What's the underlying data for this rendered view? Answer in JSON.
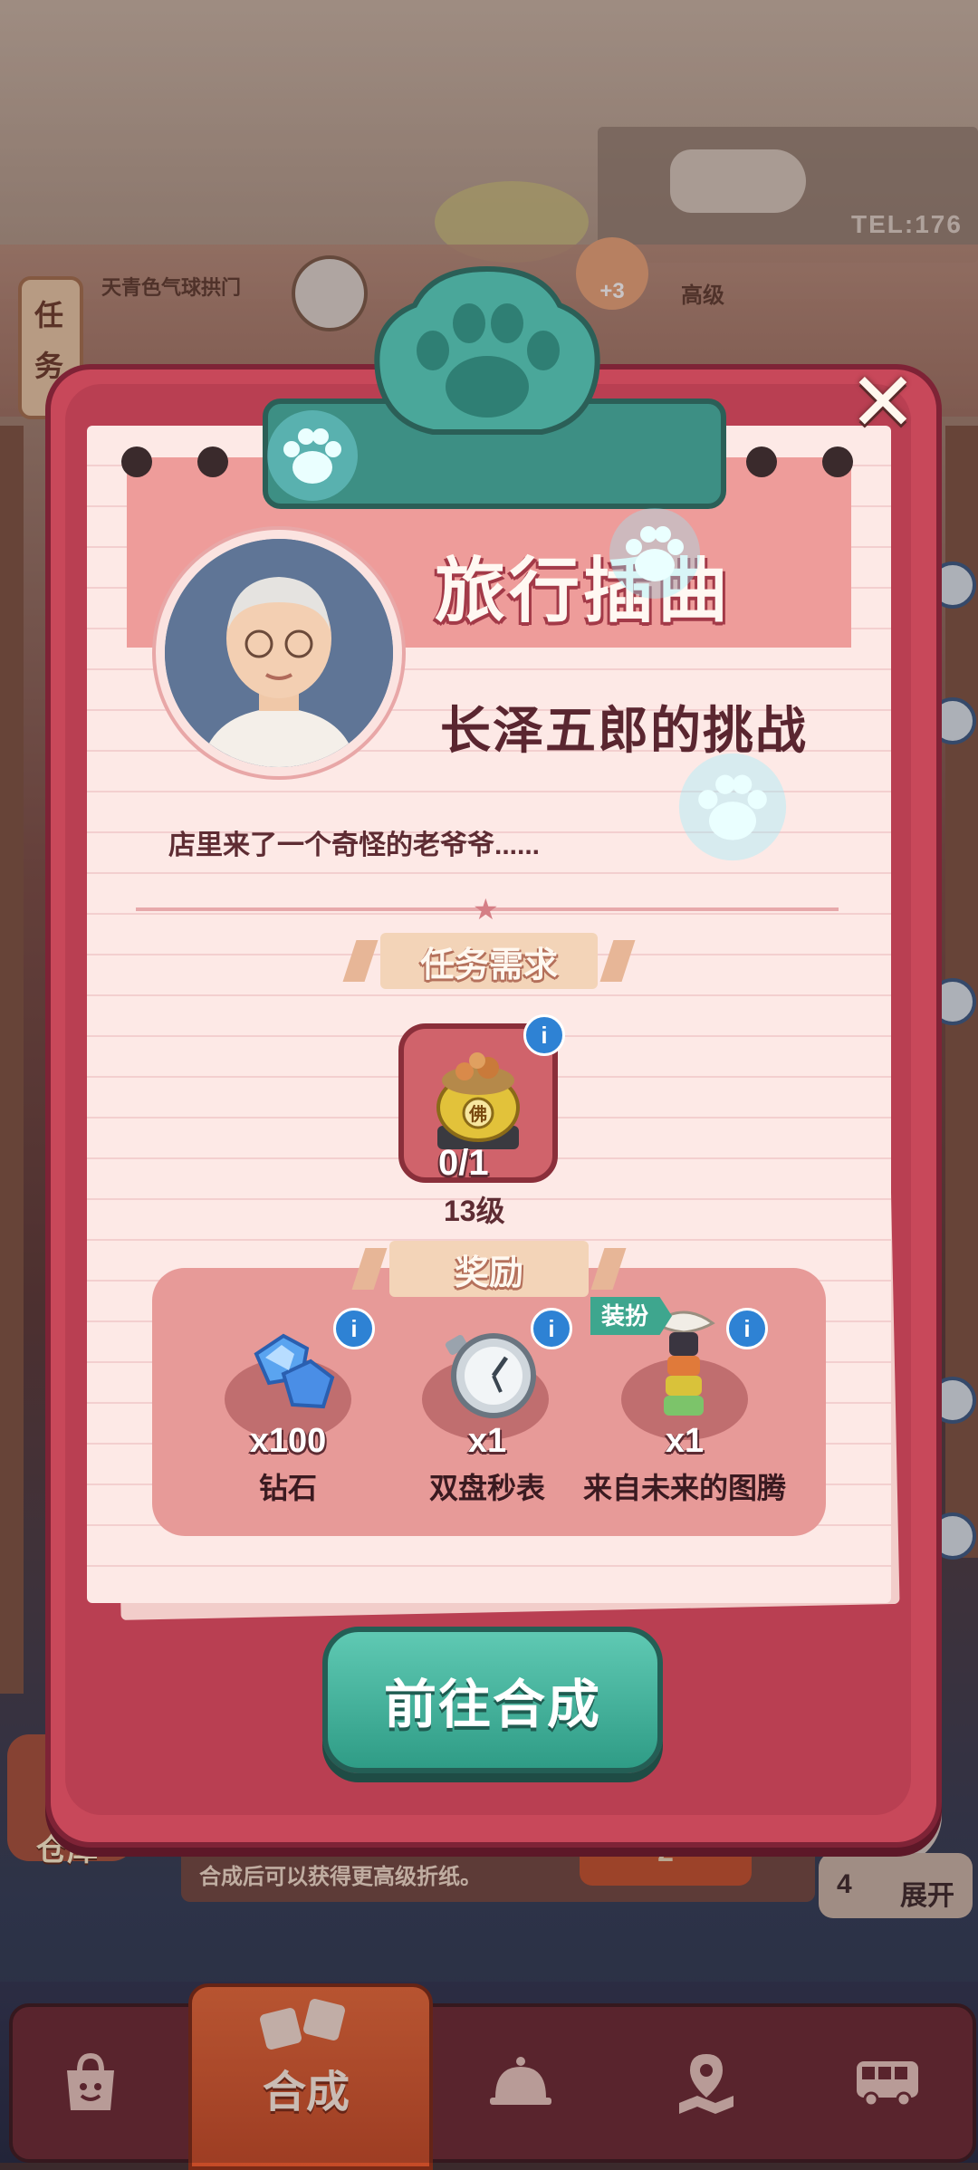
{
  "background": {
    "task_button_label": "任务",
    "task_label_1": "天青色气球拱门",
    "task_label_2": "高级",
    "reward_badge": "+3",
    "sign_tel": "TEL:176",
    "warehouse_label": "仓库",
    "hint_text": "合成后可以获得更高级折纸。",
    "hint_number": "2",
    "expand_count": "4",
    "expand_label": "展开"
  },
  "modal": {
    "title": "旅行插曲",
    "subtitle": "长泽五郎的挑战",
    "description": "店里来了一个奇怪的老爷爷......",
    "requirement_header": "任务需求",
    "requirement": {
      "count": "0/1",
      "level": "13级",
      "item_mark": "佛"
    },
    "reward_header": "奖励",
    "rewards": [
      {
        "qty": "x100",
        "name": "钻石",
        "icon": "diamond-icon"
      },
      {
        "qty": "x1",
        "name": "双盘秒表",
        "icon": "stopwatch-icon"
      },
      {
        "qty": "x1",
        "name": "来自未来的图腾",
        "icon": "totem-icon",
        "tag": "装扮"
      }
    ],
    "go_button_label": "前往合成",
    "close_symbol": "✕"
  },
  "nav": {
    "items": [
      {
        "label": "",
        "icon": "shop-bag-icon"
      },
      {
        "label": "合成",
        "icon": "merge-paper-icon"
      },
      {
        "label": "",
        "icon": "service-bell-icon"
      },
      {
        "label": "",
        "icon": "map-pin-icon"
      },
      {
        "label": "",
        "icon": "bus-icon"
      }
    ]
  },
  "colors": {
    "modal_frame": "#c8485a",
    "paper": "#fde9e6",
    "go_button": "#3aa891",
    "info": "#2e82d4",
    "nav_active": "#e86a3a"
  }
}
